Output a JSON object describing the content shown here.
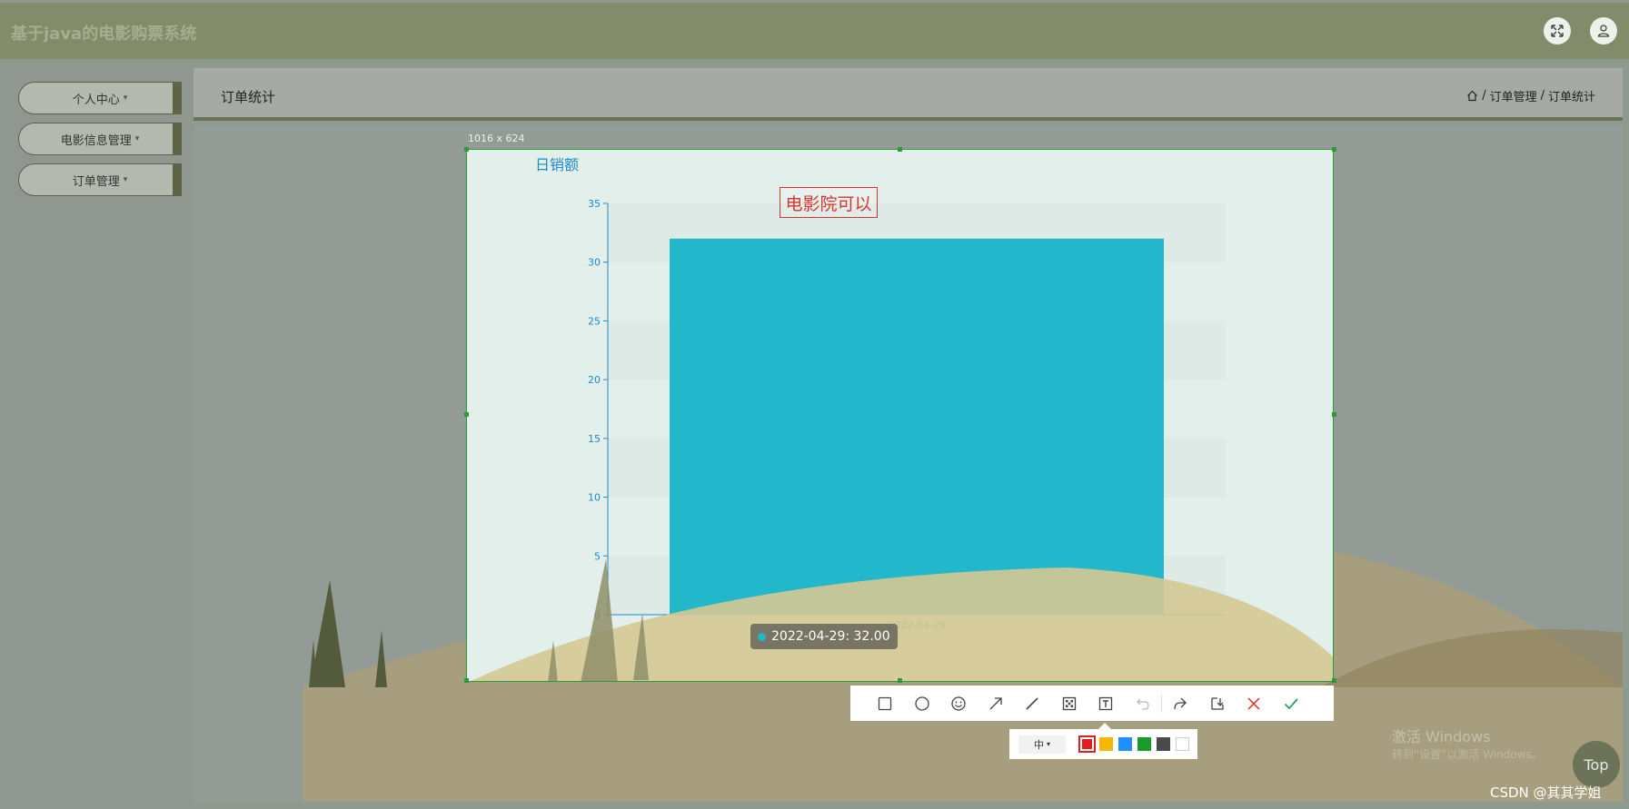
{
  "header": {
    "app_title": "基于java的电影购票系统",
    "fullscreen_icon": "fullscreen-icon",
    "user_icon": "user-icon"
  },
  "sidebar": {
    "items": [
      {
        "label": "个人中心"
      },
      {
        "label": "电影信息管理"
      },
      {
        "label": "订单管理"
      }
    ]
  },
  "page": {
    "title": "订单统计",
    "breadcrumb": {
      "home_icon": "home-icon",
      "separator": "/",
      "level1": "订单管理",
      "level2": "订单统计"
    }
  },
  "screenshot_tool": {
    "size_label": "1016 x 624",
    "text_annotation": "电影院可以",
    "tooltip": "2022-04-29: 32.00",
    "tools": [
      "rect-icon",
      "circle-icon",
      "emoji-icon",
      "arrow-icon",
      "line-icon",
      "mosaic-icon",
      "text-icon",
      "undo-icon",
      "share-icon",
      "download-icon",
      "close-icon",
      "confirm-icon"
    ],
    "font_size_option": "中",
    "colors": [
      "#e02020",
      "#f5b800",
      "#1e90ff",
      "#1a9a2a",
      "#4a4a4a",
      "#ffffff"
    ],
    "selected_color": "#e02020"
  },
  "chart_data": {
    "type": "bar",
    "title": "日销额",
    "categories": [
      "2022-04-29"
    ],
    "values": [
      32
    ],
    "ylim": [
      0,
      35
    ],
    "yticks": [
      0,
      5,
      10,
      15,
      20,
      25,
      30,
      35
    ],
    "bar_color": "#22b7ca",
    "grid": "striped"
  },
  "overlays": {
    "windows_watermark": "激活 Windows",
    "windows_watermark_sub": "转到“设置”以激活 Windows。",
    "top_button": "Top",
    "csdn_watermark": "CSDN @其其学姐"
  }
}
